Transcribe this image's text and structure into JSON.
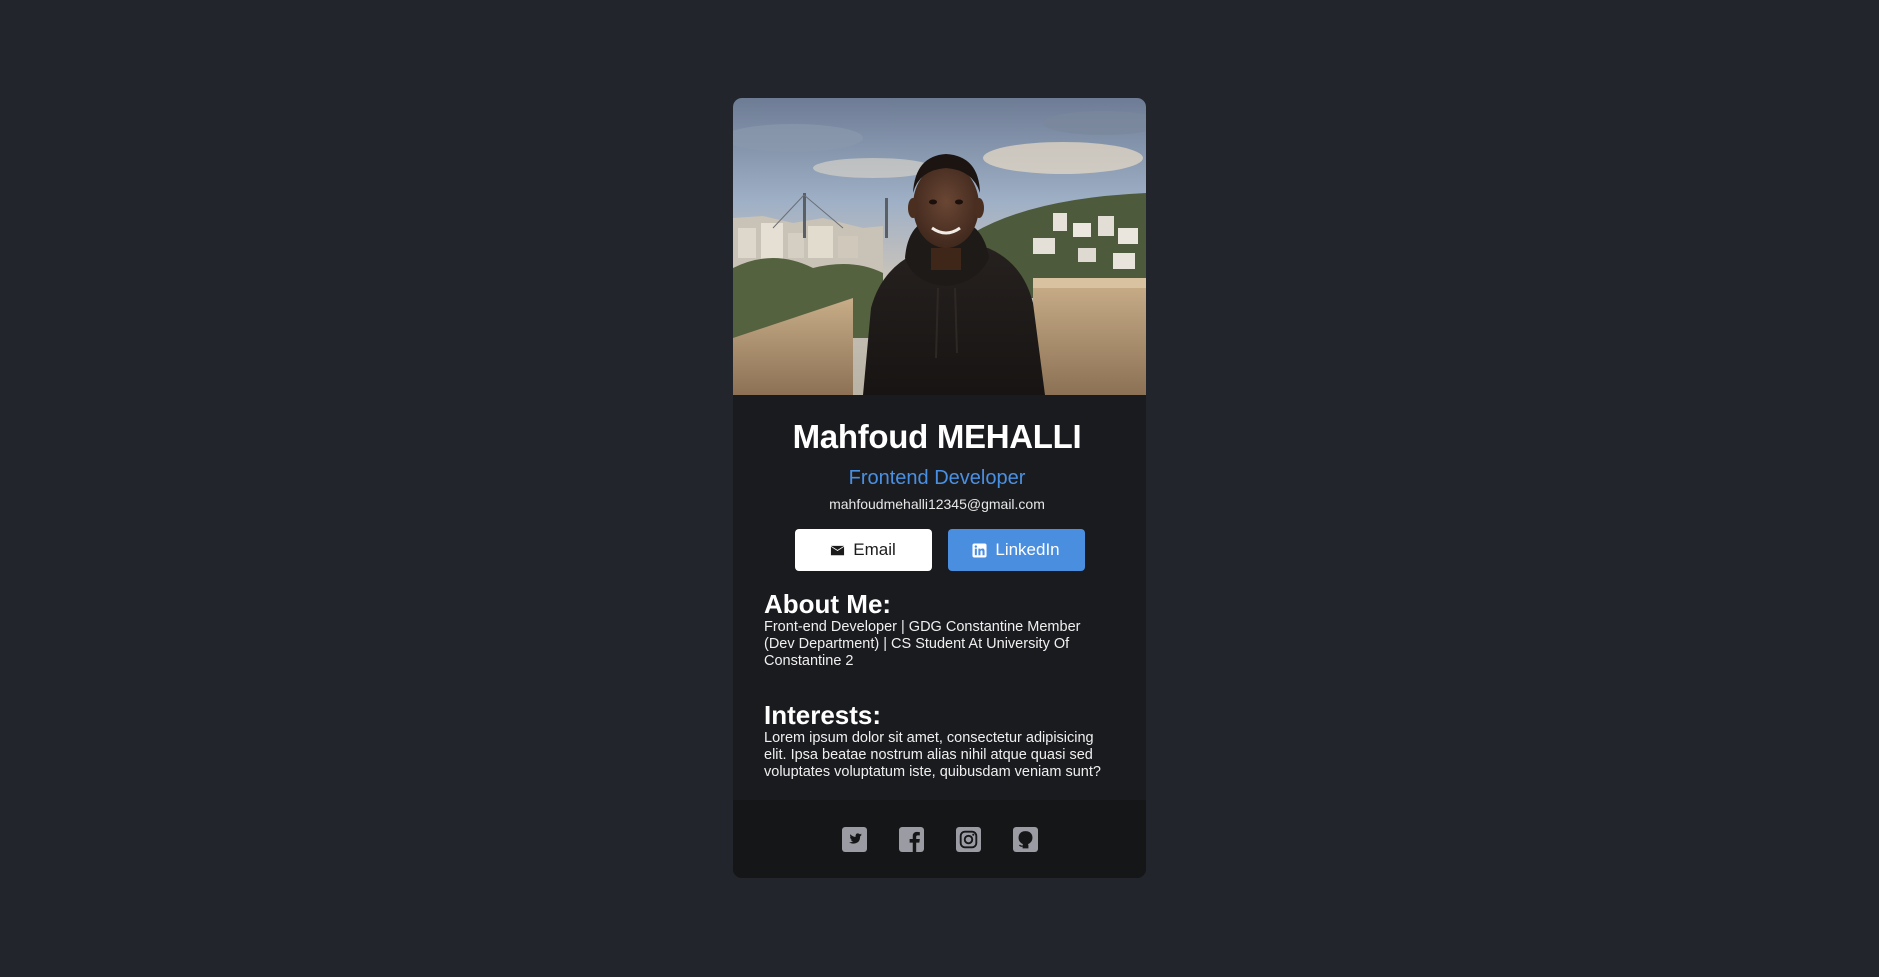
{
  "profile": {
    "name": "Mahfoud MEHALLI",
    "role": "Frontend Developer",
    "email": "mahfoudmehalli12345@gmail.com"
  },
  "buttons": {
    "email_label": "Email",
    "linkedin_label": "LinkedIn"
  },
  "about": {
    "heading": "About Me:",
    "text": "Front-end Developer | GDG Constantine Member (Dev Department) | CS Student At University Of Constantine 2"
  },
  "interests": {
    "heading": "Interests:",
    "text": "Lorem ipsum dolor sit amet, consectetur adipisicing elit. Ipsa beatae nostrum alias nihil atque quasi sed voluptates voluptatum iste, quibusdam veniam sunt?"
  },
  "social_icons": [
    "twitter-icon",
    "facebook-icon",
    "instagram-icon",
    "github-icon"
  ],
  "colors": {
    "background": "#23252c",
    "card": "#1a1b1f",
    "footer": "#151618",
    "accent": "#4a90e2",
    "icon": "#9a9ba3"
  }
}
